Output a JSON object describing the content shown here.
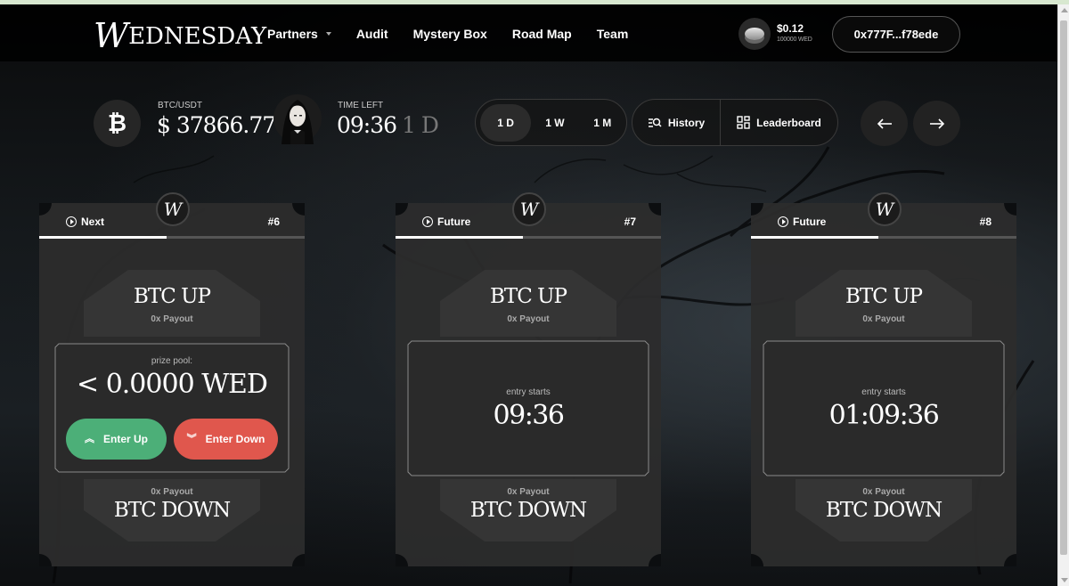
{
  "brand": {
    "logo_text": "EDNESDAY",
    "logo_initial": "W"
  },
  "nav": [
    {
      "label": "Partners",
      "has_dropdown": true
    },
    {
      "label": "Audit"
    },
    {
      "label": "Mystery Box"
    },
    {
      "label": "Road Map"
    },
    {
      "label": "Team"
    }
  ],
  "balance": {
    "price": "$0.12",
    "amount": "100000 WED"
  },
  "wallet": {
    "address": "0x777F...f78ede"
  },
  "ticker": {
    "pair_label": "BTC/USDT",
    "pair_price": "$ 37866.77",
    "time_label": "TIME LEFT",
    "time_value": "09:36",
    "time_period": "1 D"
  },
  "periods": [
    {
      "label": "1 D",
      "active": true
    },
    {
      "label": "1 W",
      "active": false
    },
    {
      "label": "1 M",
      "active": false
    }
  ],
  "actions": {
    "history": "History",
    "leaderboard": "Leaderboard"
  },
  "cards": [
    {
      "status": "Next",
      "round": "#6",
      "progress": 0.48,
      "up_title": "BTC UP",
      "up_payout": "0x Payout",
      "pool_label": "prize pool:",
      "pool_value": "< 0.0000 WED",
      "enter_up": "Enter Up",
      "enter_down": "Enter Down",
      "down_payout": "0x Payout",
      "down_title": "BTC DOWN"
    },
    {
      "status": "Future",
      "round": "#7",
      "progress": 0.48,
      "up_title": "BTC UP",
      "up_payout": "0x Payout",
      "entry_label": "entry starts",
      "entry_value": "09:36",
      "down_payout": "0x Payout",
      "down_title": "BTC DOWN"
    },
    {
      "status": "Future",
      "round": "#8",
      "progress": 0.48,
      "up_title": "BTC UP",
      "up_payout": "0x Payout",
      "entry_label": "entry starts",
      "entry_value": "01:09:36",
      "down_payout": "0x Payout",
      "down_title": "BTC DOWN"
    }
  ],
  "colors": {
    "enter_up": "#4caf78",
    "enter_down": "#e0574d",
    "background": "#0c0e10"
  }
}
